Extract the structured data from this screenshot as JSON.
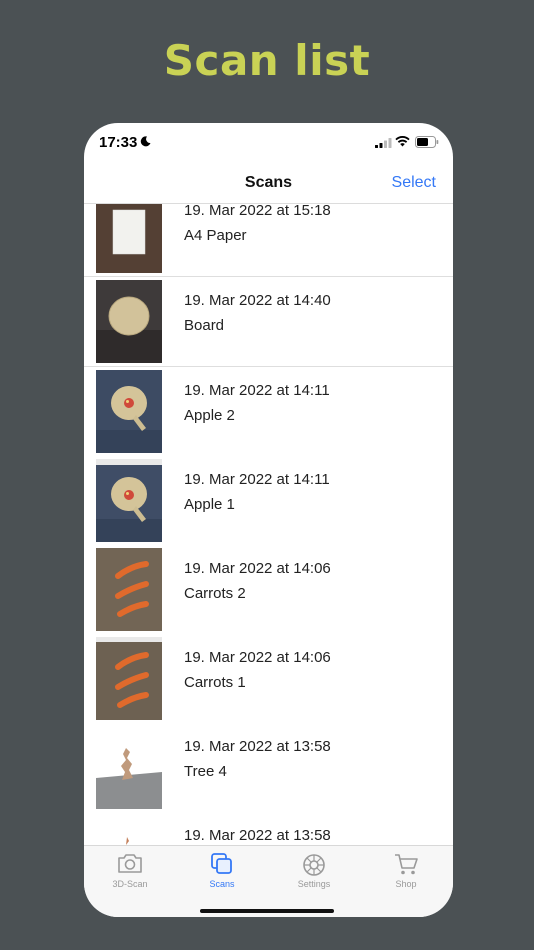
{
  "headline": "Scan list",
  "status_bar": {
    "time": "17:33"
  },
  "nav": {
    "title": "Scans",
    "select_label": "Select"
  },
  "scans": [
    {
      "date": "19. Mar 2022 at 15:18",
      "name": "A4 Paper",
      "thumb": "paper"
    },
    {
      "date": "19. Mar 2022 at 14:40",
      "name": "Board",
      "thumb": "board"
    },
    {
      "date": "19. Mar 2022 at 14:11",
      "name": "Apple 2",
      "thumb": "apple"
    },
    {
      "date": "19. Mar 2022 at 14:11",
      "name": "Apple 1",
      "thumb": "apple"
    },
    {
      "date": "19. Mar 2022 at 14:06",
      "name": "Carrots 2",
      "thumb": "carrots"
    },
    {
      "date": "19. Mar 2022 at 14:06",
      "name": "Carrots 1",
      "thumb": "carrots"
    },
    {
      "date": "19. Mar 2022 at 13:58",
      "name": "Tree 4",
      "thumb": "tree"
    },
    {
      "date": "19. Mar 2022 at 13:58",
      "name": "",
      "thumb": "tree"
    }
  ],
  "tabs": [
    {
      "label": "3D-Scan",
      "icon": "camera-icon",
      "active": false
    },
    {
      "label": "Scans",
      "icon": "scans-icon",
      "active": true
    },
    {
      "label": "Settings",
      "icon": "gear-icon",
      "active": false
    },
    {
      "label": "Shop",
      "icon": "cart-icon",
      "active": false
    }
  ],
  "colors": {
    "background": "#4b5154",
    "headline": "#c9d255",
    "accent": "#3478f6",
    "inactive_tab": "#9a9a9a"
  }
}
